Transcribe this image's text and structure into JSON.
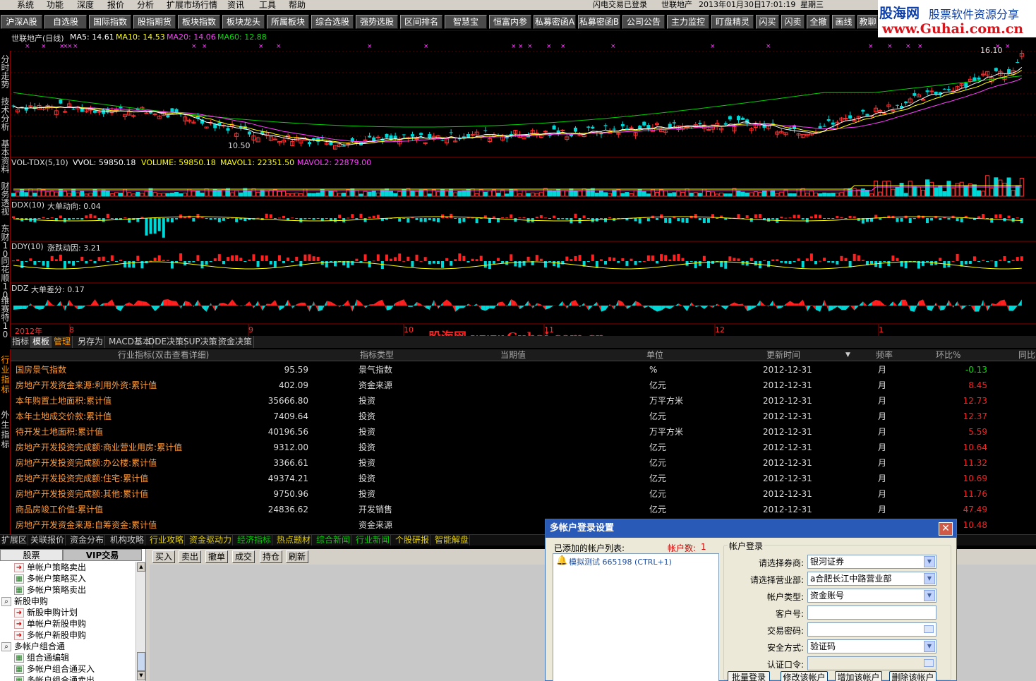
{
  "menu": {
    "items": [
      "系统",
      "功能",
      "深度",
      "报价",
      "分析",
      "扩展市场行情",
      "资讯",
      "工具",
      "帮助"
    ],
    "status": [
      "闪电交易已登录",
      "世联地产",
      "2013年01月30日",
      "17:01:19",
      "星期三"
    ]
  },
  "logo": {
    "line1": "股海网",
    "line2": "股票软件资源分享",
    "line3": "www.Guhai.com.cn"
  },
  "toolbar": {
    "buttons": [
      "沪深A股",
      "自选股",
      "国际指数",
      "股指期货",
      "板块指数",
      "板块龙头",
      "所属板块",
      "综合选股",
      "强势选股",
      "区间排名",
      "智慧宝",
      "恒富内参",
      "私募密函A",
      "私募密函B",
      "公司公告",
      "主力监控",
      "盯盘精灵",
      "闪买",
      "闪卖",
      "全撤",
      "画线",
      "教聊"
    ]
  },
  "left_tabs": [
    "分时走势",
    "技术分析",
    "基本资料",
    "财务透视",
    "东财10",
    "同花顺10",
    "维赛特10"
  ],
  "chart": {
    "title": "世联地产(日线)",
    "ma": [
      {
        "label": "MA5: 14.61",
        "color": "#ffffff"
      },
      {
        "label": "MA10: 14.53",
        "color": "#ffff00"
      },
      {
        "label": "MA20: 14.06",
        "color": "#ff00ff"
      },
      {
        "label": "MA60: 12.88",
        "color": "#00e000"
      }
    ],
    "high_label": "16.10",
    "low_label": "10.50",
    "vol": {
      "name": "VOL-TDX(5,10)",
      "vvol": "VVOL: 59850.18",
      "volume": "VOLUME: 59850.18",
      "mavol1": "MAVOL1: 22351.50",
      "mavol2": "MAVOL2: 22879.00"
    },
    "ddx": {
      "name": "DDX(10)",
      "desc": "大单动向: 0.04"
    },
    "ddy": {
      "name": "DDY(10)",
      "desc": "涨跌动因: 3.21"
    },
    "ddz": {
      "name": "DDZ",
      "desc": "大单差分: 0.17"
    },
    "dates": [
      "2012年",
      "8",
      "9",
      "10",
      "11",
      "12",
      "1"
    ],
    "watermark": "股海网   www.Guhai.com.cn"
  },
  "chart_data": {
    "type": "candlestick",
    "stock": "世联地产",
    "period": "日线",
    "x_months": [
      "2012年",
      "8",
      "9",
      "10",
      "11",
      "12",
      "1"
    ],
    "price_max_label": 16.1,
    "price_min_label": 10.5,
    "ma": {
      "MA5": 14.61,
      "MA10": 14.53,
      "MA20": 14.06,
      "MA60": 12.88
    },
    "volume": {
      "VVOL": 59850.18,
      "VOLUME": 59850.18,
      "MAVOL1": 22351.5,
      "MAVOL2": 22879.0
    },
    "DDX": 0.04,
    "DDY": 3.21,
    "DDZ": 0.17
  },
  "bottom_tabs": [
    "指标",
    "模板",
    "管理",
    "另存为",
    "MACD基本",
    "DDE决策",
    "SUP决策",
    "资金决策"
  ],
  "ind_left": [
    "行业指标",
    "外生指标"
  ],
  "table": {
    "headers": [
      "行业指标(双击查看详细)",
      "指标类型",
      "当期值",
      "单位",
      "更新时间",
      "频率",
      "环比%",
      "同比"
    ],
    "rows": [
      {
        "name": "国房景气指数",
        "type": "景气指数",
        "value": "95.59",
        "unit": "%",
        "time": "2012-12-31",
        "freq": "月",
        "ring": "-0.13"
      },
      {
        "name": "房地产开发资金来源:利用外资:累计值",
        "type": "资金来源",
        "value": "402.09",
        "unit": "亿元",
        "time": "2012-12-31",
        "freq": "月",
        "ring": "8.45"
      },
      {
        "name": "本年购置土地面积:累计值",
        "type": "投资",
        "value": "35666.80",
        "unit": "万平方米",
        "time": "2012-12-31",
        "freq": "月",
        "ring": "12.73"
      },
      {
        "name": "本年土地成交价款:累计值",
        "type": "投资",
        "value": "7409.64",
        "unit": "亿元",
        "time": "2012-12-31",
        "freq": "月",
        "ring": "12.37"
      },
      {
        "name": "待开发土地面积:累计值",
        "type": "投资",
        "value": "40196.56",
        "unit": "万平方米",
        "time": "2012-12-31",
        "freq": "月",
        "ring": "5.59"
      },
      {
        "name": "房地产开发投资完成额:商业营业用房:累计值",
        "type": "投资",
        "value": "9312.00",
        "unit": "亿元",
        "time": "2012-12-31",
        "freq": "月",
        "ring": "10.64"
      },
      {
        "name": "房地产开发投资完成额:办公楼:累计值",
        "type": "投资",
        "value": "3366.61",
        "unit": "亿元",
        "time": "2012-12-31",
        "freq": "月",
        "ring": "11.32"
      },
      {
        "name": "房地产开发投资完成额:住宅:累计值",
        "type": "投资",
        "value": "49374.21",
        "unit": "亿元",
        "time": "2012-12-31",
        "freq": "月",
        "ring": "10.69"
      },
      {
        "name": "房地产开发投资完成额:其他:累计值",
        "type": "投资",
        "value": "9750.96",
        "unit": "亿元",
        "time": "2012-12-31",
        "freq": "月",
        "ring": "11.76"
      },
      {
        "name": "商品房竣工价值:累计值",
        "type": "开发销售",
        "value": "24836.62",
        "unit": "亿元",
        "time": "2012-12-31",
        "freq": "月",
        "ring": "47.49"
      },
      {
        "name": "房地产开发资金来源:自筹资金:累计值",
        "type": "资金来源",
        "value": "",
        "unit": "",
        "time": "",
        "freq": "",
        "ring": "10.48"
      }
    ]
  },
  "status_tabs": [
    "扩展区",
    "关联报价",
    "资金分布",
    "机构攻略",
    "行业攻略",
    "资金驱动力",
    "经济指标",
    "热点题材",
    "综合新闻",
    "行业新闻",
    "个股研报",
    "智能解盘"
  ],
  "left_panel": {
    "tabs": [
      "股票",
      "VIP交易"
    ],
    "tree": [
      {
        "label": "单帐户策略卖出",
        "indent": 20,
        "icon": "➜",
        "cls": "red"
      },
      {
        "label": "多帐户策略买入",
        "indent": 20,
        "icon": "▦",
        "cls": "mix"
      },
      {
        "label": "多帐户策略卖出",
        "indent": 20,
        "icon": "▦",
        "cls": "mix"
      },
      {
        "label": "新股申购",
        "indent": 2,
        "icon": "⌕",
        "cls": ""
      },
      {
        "label": "新股申购计划",
        "indent": 20,
        "icon": "➜",
        "cls": "red"
      },
      {
        "label": "单帐户新股申购",
        "indent": 20,
        "icon": "➜",
        "cls": "red"
      },
      {
        "label": "多帐户新股申购",
        "indent": 20,
        "icon": "➜",
        "cls": "red"
      },
      {
        "label": "多帐户组合通",
        "indent": 2,
        "icon": "⌕",
        "cls": ""
      },
      {
        "label": "组合通编辑",
        "indent": 20,
        "icon": "▦",
        "cls": "mix"
      },
      {
        "label": "多帐户组合通买入",
        "indent": 20,
        "icon": "▦",
        "cls": "mix"
      },
      {
        "label": "多帐户组合通卖出",
        "indent": 20,
        "icon": "▦",
        "cls": "mix"
      }
    ]
  },
  "trade_buttons": [
    "买入",
    "卖出",
    "撤单",
    "成交",
    "持仓",
    "刷新"
  ],
  "dialog": {
    "title": "多帐户登录设置",
    "list_label": "已添加的帐户列表:",
    "count_label": "帐户数:",
    "count": "1",
    "account": "模拟测试  665198 (CTRL+1)",
    "group_label": "帐户登录",
    "fields": [
      {
        "label": "请选择券商:",
        "value": "银河证券",
        "kind": "select"
      },
      {
        "label": "请选择营业部:",
        "value": "a合肥长江中路营业部",
        "kind": "select"
      },
      {
        "label": "帐户类型:",
        "value": "资金账号",
        "kind": "select"
      },
      {
        "label": "客户号:",
        "value": "",
        "kind": "input"
      },
      {
        "label": "交易密码:",
        "value": "",
        "kind": "password"
      },
      {
        "label": "安全方式:",
        "value": "验证码",
        "kind": "select"
      },
      {
        "label": "认证口令:",
        "value": "",
        "kind": "password-disabled"
      }
    ],
    "buttons": [
      "批量登录",
      "修改该帐户",
      "增加该帐户",
      "删除该帐户"
    ]
  }
}
